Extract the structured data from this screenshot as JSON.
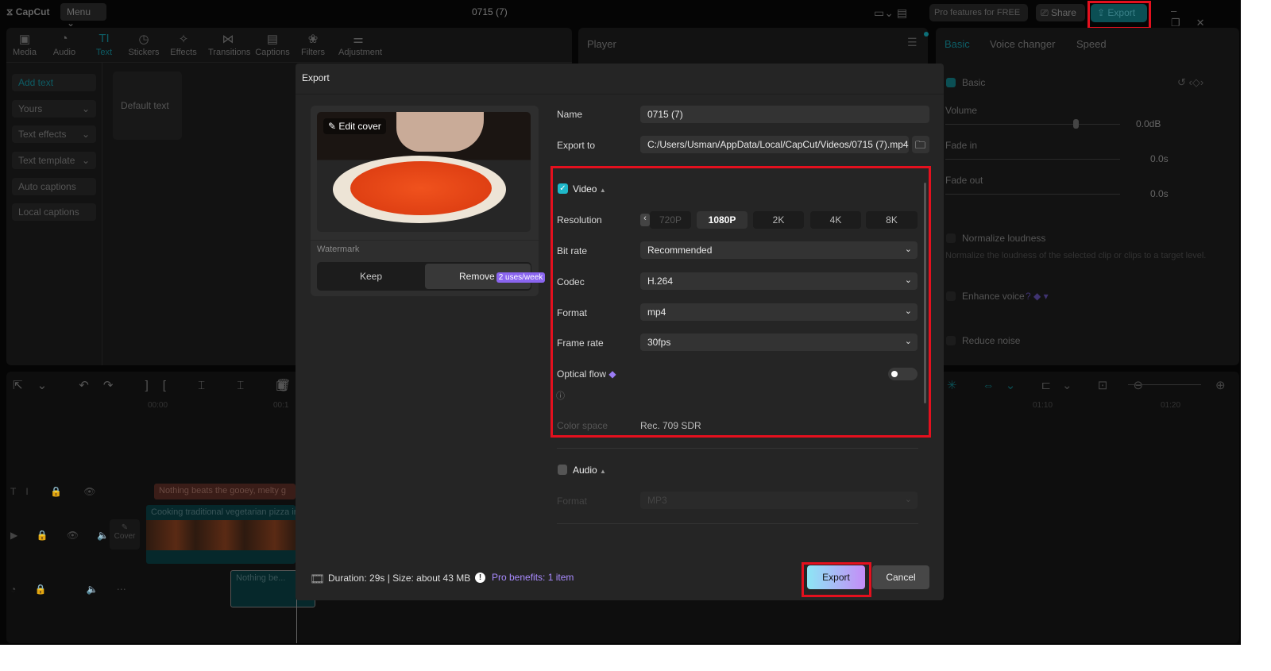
{
  "app": {
    "logo": "CapCut",
    "menu": "Menu",
    "project_title": "0715 (7)",
    "pro_features": "Pro features for FREE",
    "share": "Share",
    "export": "Export"
  },
  "toolbar": [
    {
      "icon": "media-icon",
      "label": "Media"
    },
    {
      "icon": "audio-icon",
      "label": "Audio"
    },
    {
      "icon": "text-icon",
      "label": "Text",
      "active": true
    },
    {
      "icon": "stickers-icon",
      "label": "Stickers"
    },
    {
      "icon": "effects-icon",
      "label": "Effects"
    },
    {
      "icon": "transitions-icon",
      "label": "Transitions"
    },
    {
      "icon": "captions-icon",
      "label": "Captions"
    },
    {
      "icon": "filters-icon",
      "label": "Filters"
    },
    {
      "icon": "adjustment-icon",
      "label": "Adjustment"
    }
  ],
  "sidebar": {
    "items": [
      {
        "label": "Add text"
      },
      {
        "label": "Yours"
      },
      {
        "label": "Text effects"
      },
      {
        "label": "Text template"
      },
      {
        "label": "Auto captions"
      },
      {
        "label": "Local captions"
      }
    ],
    "default_text": "Default text"
  },
  "player": {
    "title": "Player"
  },
  "right_panel": {
    "tabs": [
      "Basic",
      "Voice changer",
      "Speed"
    ],
    "section": "Basic",
    "volume_label": "Volume",
    "volume_value": "0.0dB",
    "fade_in_label": "Fade in",
    "fade_in_value": "0.0s",
    "fade_out_label": "Fade out",
    "fade_out_value": "0.0s",
    "normalize": "Normalize loudness",
    "normalize_desc": "Normalize the loudness of the selected clip or clips to a target level.",
    "enhance": "Enhance voice",
    "reduce": "Reduce noise"
  },
  "timeline": {
    "ticks": [
      "00:00",
      "00:1",
      "01:10",
      "01:20"
    ],
    "text_clip": "Nothing beats the gooey, melty g",
    "video_clip": "Cooking traditional vegetarian pizza in",
    "audio_clip": "Nothing be...",
    "cover": "Cover"
  },
  "dialog": {
    "title": "Export",
    "edit_cover": "Edit cover",
    "watermark_label": "Watermark",
    "keep": "Keep",
    "remove": "Remove",
    "remove_badge": "2 uses/week",
    "name_label": "Name",
    "name_value": "0715 (7)",
    "export_to_label": "Export to",
    "export_to_value": "C:/Users/Usman/AppData/Local/CapCut/Videos/0715 (7).mp4",
    "video_label": "Video",
    "video_checked": true,
    "resolution_label": "Resolution",
    "resolutions": [
      "720P",
      "1080P",
      "2K",
      "4K",
      "8K"
    ],
    "resolution_selected": "1080P",
    "bitrate_label": "Bit rate",
    "bitrate_value": "Recommended",
    "codec_label": "Codec",
    "codec_value": "H.264",
    "format_label": "Format",
    "format_value": "mp4",
    "framerate_label": "Frame rate",
    "framerate_value": "30fps",
    "optical_flow_label": "Optical flow",
    "optical_flow_on": false,
    "color_space_label": "Color space",
    "color_space_value": "Rec. 709 SDR",
    "audio_label": "Audio",
    "audio_checked": false,
    "audio_format_label": "Format",
    "audio_format_value": "MP3",
    "footer_info": "Duration: 29s | Size: about 43 MB",
    "pro_benefits": "Pro benefits: 1 item",
    "export_button": "Export",
    "cancel_button": "Cancel"
  },
  "colors": {
    "accent": "#1fb8c9",
    "highlight": "#e4101e",
    "pro": "#9b7cf6"
  }
}
